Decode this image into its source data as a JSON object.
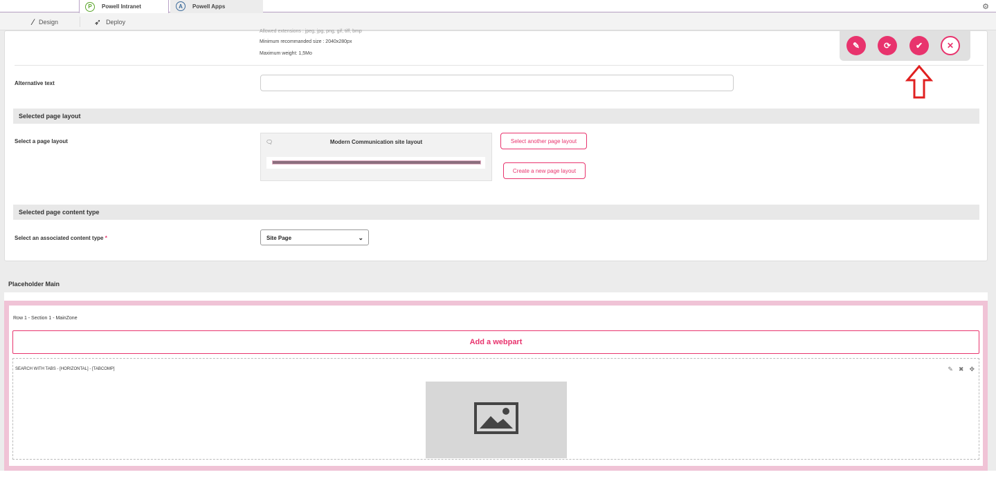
{
  "tabs": [
    {
      "label": "Powell Intranet",
      "logo": "P"
    },
    {
      "label": "Powell Apps",
      "logo": "A"
    }
  ],
  "subbar": {
    "design_label": "Design",
    "deploy_label": "Deploy"
  },
  "image_info": {
    "allowed": "Allowed extensions : jpeg, jpg, png, gif, tiff, bmp",
    "min_size": "Minimum recommanded size : 2040x280px",
    "max_weight": "Maximum weight: 1,5Mo"
  },
  "alt_text": {
    "label": "Alternative text",
    "value": ""
  },
  "page_layout": {
    "section_title": "Selected page layout",
    "label": "Select a page layout",
    "layout_name": "Modern Communication site layout",
    "select_another_label": "Select another page layout",
    "create_new_label": "Create a new page layout"
  },
  "content_type": {
    "section_title": "Selected page content type",
    "label": "Select an associated content type",
    "required_mark": "*",
    "selected_value": "Site Page"
  },
  "placeholder": {
    "title": "Placeholder Main",
    "zone_label": "Row 1 - Section 1 - MainZone",
    "add_webpart_label": "Add a webpart",
    "webpart_label": "SEARCH WITH TABS - [HORIZONTAL] - [TABCOMP]"
  },
  "colors": {
    "accent": "#e8336d",
    "arrow": "#e02020",
    "zone_border": "#f0c3d6"
  }
}
